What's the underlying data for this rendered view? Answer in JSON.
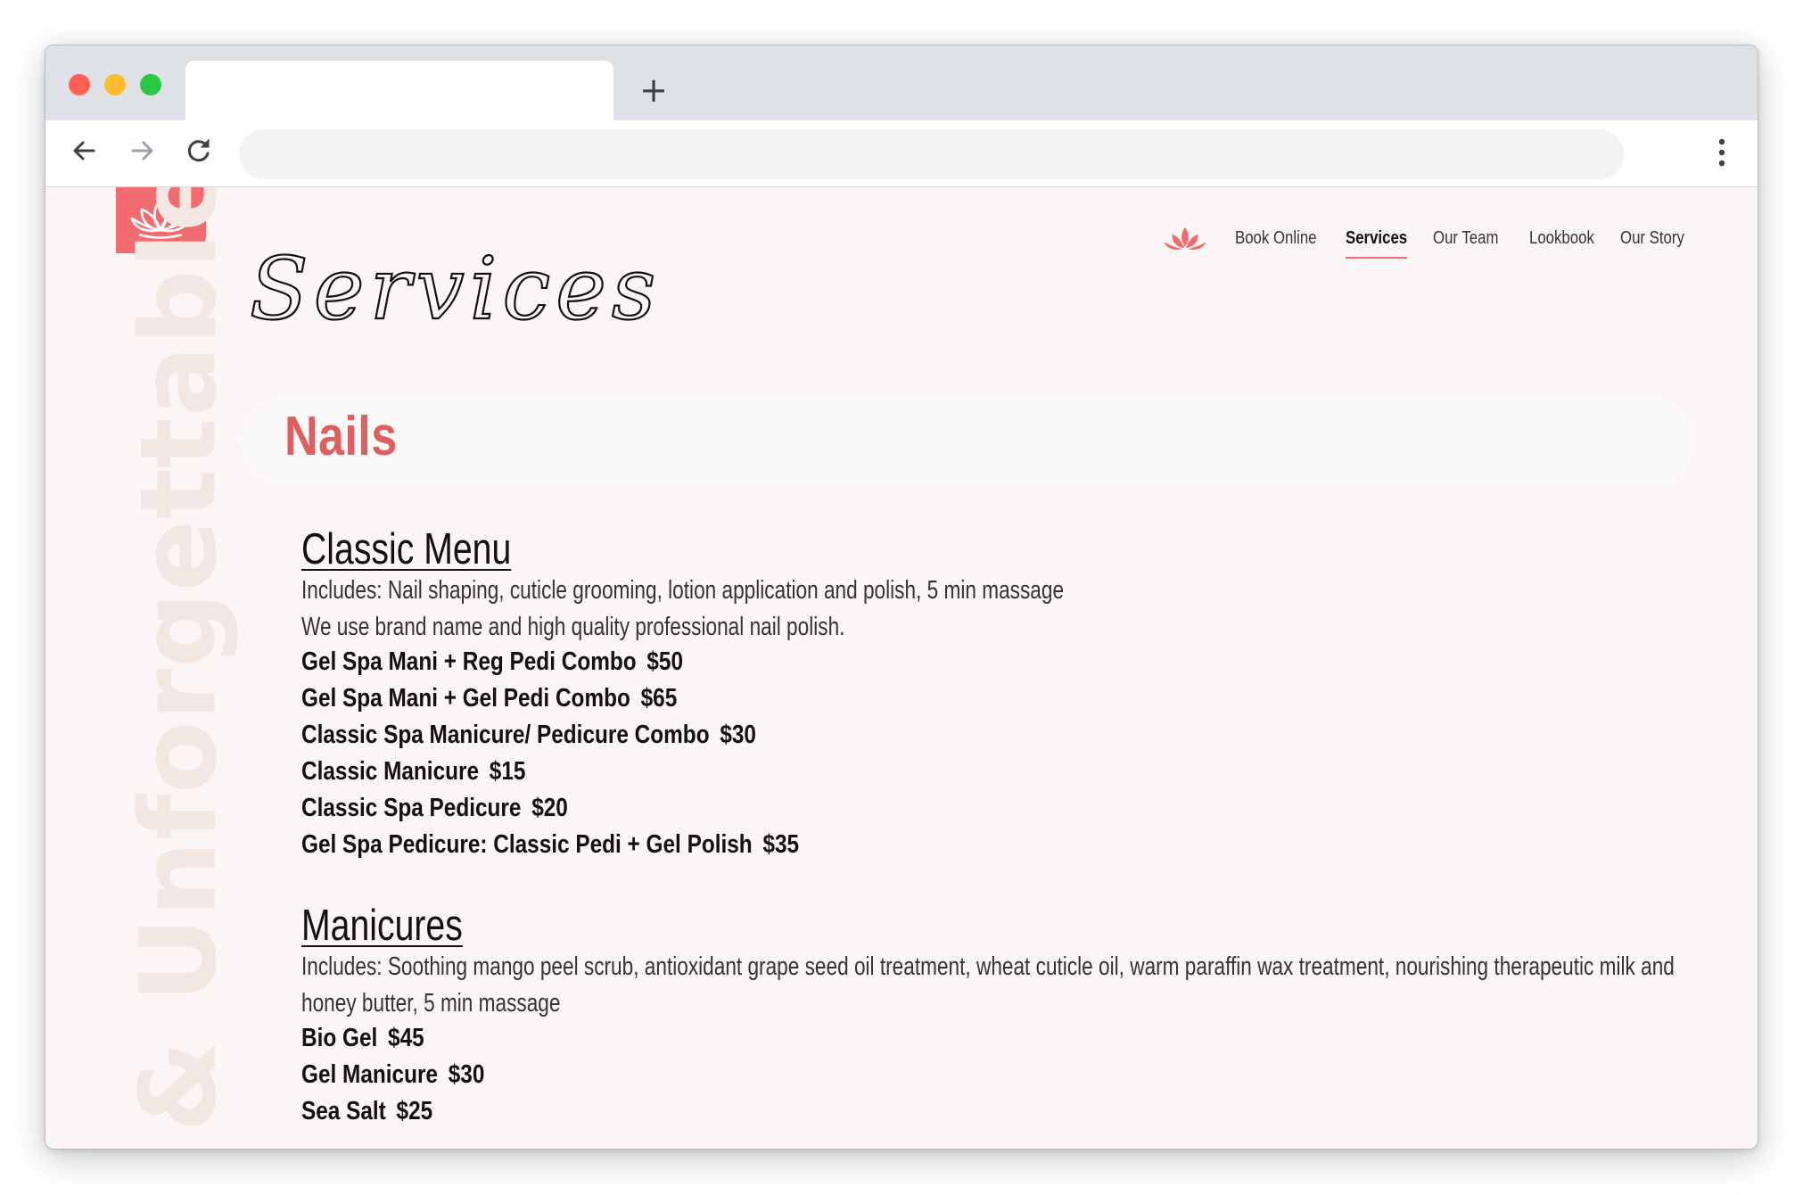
{
  "browser": {
    "tab_title": "",
    "new_tab_label": "+",
    "address": "",
    "back_icon": "arrow-left-icon",
    "forward_icon": "arrow-right-icon",
    "reload_icon": "reload-icon",
    "menu_icon": "kebab-menu-icon"
  },
  "site": {
    "brand_color": "#f26b6e",
    "logo_icon": "lotus-icon",
    "nav": [
      {
        "label": "Book Online",
        "active": false
      },
      {
        "label": "Services",
        "active": true
      },
      {
        "label": "Our Team",
        "active": false
      },
      {
        "label": "Lookbook",
        "active": false
      },
      {
        "label": "Our Story",
        "active": false
      }
    ],
    "vertical_tagline": "& Unforgettable"
  },
  "page": {
    "script_title": "Services",
    "section_title": "Nails",
    "section_color": "#df5e60",
    "menus": [
      {
        "heading": "Classic Menu",
        "description": [
          "Includes: Nail shaping, cuticle grooming, lotion application and polish, 5 min massage",
          "We use brand name and high quality professional nail polish."
        ],
        "items": [
          {
            "name": "Gel Spa Mani + Reg Pedi Combo",
            "price": "$50"
          },
          {
            "name": "Gel Spa Mani + Gel Pedi Combo",
            "price": "$65"
          },
          {
            "name": "Classic Spa Manicure/ Pedicure Combo",
            "price": "$30"
          },
          {
            "name": "Classic Manicure",
            "price": "$15"
          },
          {
            "name": "Classic Spa Pedicure",
            "price": "$20"
          },
          {
            "name": "Gel Spa Pedicure: Classic Pedi + Gel Polish",
            "price": "$35"
          }
        ]
      },
      {
        "heading": "Manicures",
        "description": [
          "Includes: Soothing mango peel scrub, antioxidant grape seed oil treatment, wheat cuticle oil, warm paraffin wax treatment, nourishing therapeutic milk and",
          "honey butter, 5 min massage"
        ],
        "items": [
          {
            "name": "Bio Gel",
            "price": "$45"
          },
          {
            "name": "Gel Manicure",
            "price": "$30"
          },
          {
            "name": "Sea Salt",
            "price": "$25"
          }
        ]
      }
    ]
  }
}
